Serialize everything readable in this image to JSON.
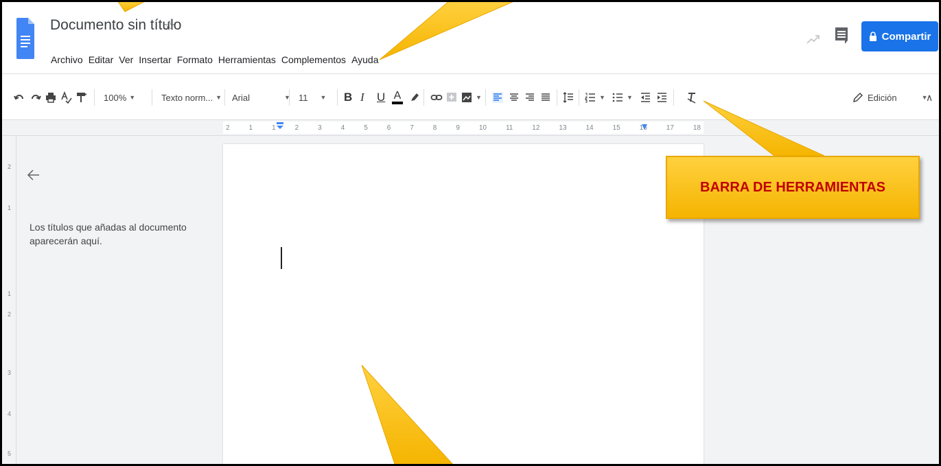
{
  "document": {
    "title": "Documento sin título"
  },
  "menu": [
    "Archivo",
    "Editar",
    "Ver",
    "Insertar",
    "Formato",
    "Herramientas",
    "Complementos",
    "Ayuda"
  ],
  "share_button": {
    "label": "Compartir"
  },
  "toolbar": {
    "zoom": "100%",
    "style": "Texto norm...",
    "font": "Arial",
    "font_size": "11",
    "bold": "B",
    "italic": "I",
    "underline": "U",
    "text_color": "A",
    "mode": "Edición"
  },
  "ruler": {
    "ticks": [
      "2",
      "1",
      "1",
      "2",
      "3",
      "4",
      "5",
      "6",
      "7",
      "8",
      "9",
      "10",
      "11",
      "12",
      "13",
      "14",
      "15",
      "16",
      "17",
      "18"
    ]
  },
  "vertical_ruler": [
    "2",
    "1",
    "1",
    "2",
    "3",
    "4",
    "5"
  ],
  "outline": {
    "empty_message": "Los títulos que añadas al documento aparecerán aquí."
  },
  "callout": {
    "label": "BARRA DE HERRAMIENTAS"
  },
  "colors": {
    "accent": "#1a73e8",
    "callout": "#ffc000",
    "callout_text": "#c00000"
  }
}
